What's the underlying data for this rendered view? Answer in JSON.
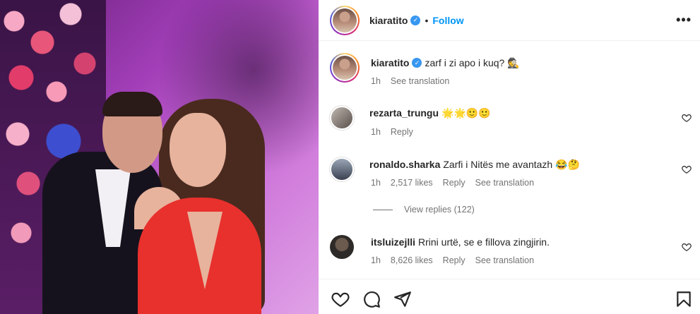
{
  "post": {
    "author": "kiaratito",
    "follow_label": "Follow",
    "dot": "•",
    "more_label": "•••",
    "caption": "zarf i zi apo i kuq? 🕵",
    "caption_time": "1h",
    "caption_see_translation": "See translation"
  },
  "comments": [
    {
      "user": "rezarta_trungu",
      "text": "🌟🌟🙂🙂",
      "time": "1h",
      "likes": "",
      "reply": "Reply",
      "translation": ""
    },
    {
      "user": "ronaldo.sharka",
      "text": "Zarfi i Nitës me avantazh 😂🤔",
      "time": "1h",
      "likes": "2,517 likes",
      "reply": "Reply",
      "translation": "See translation"
    },
    {
      "user": "itsluizejlli",
      "text": "Rrini urtë, se e fillova zingjirin.",
      "time": "1h",
      "likes": "8,626 likes",
      "reply": "Reply",
      "translation": "See translation"
    }
  ],
  "view_replies": "View replies (122)",
  "icons": {
    "verified": "verified-badge-icon",
    "like": "heart-icon",
    "comment": "comment-icon",
    "share": "share-icon",
    "save": "bookmark-icon"
  },
  "colors": {
    "accent": "#0095f6",
    "verified": "#3897f0",
    "muted": "#737373"
  }
}
